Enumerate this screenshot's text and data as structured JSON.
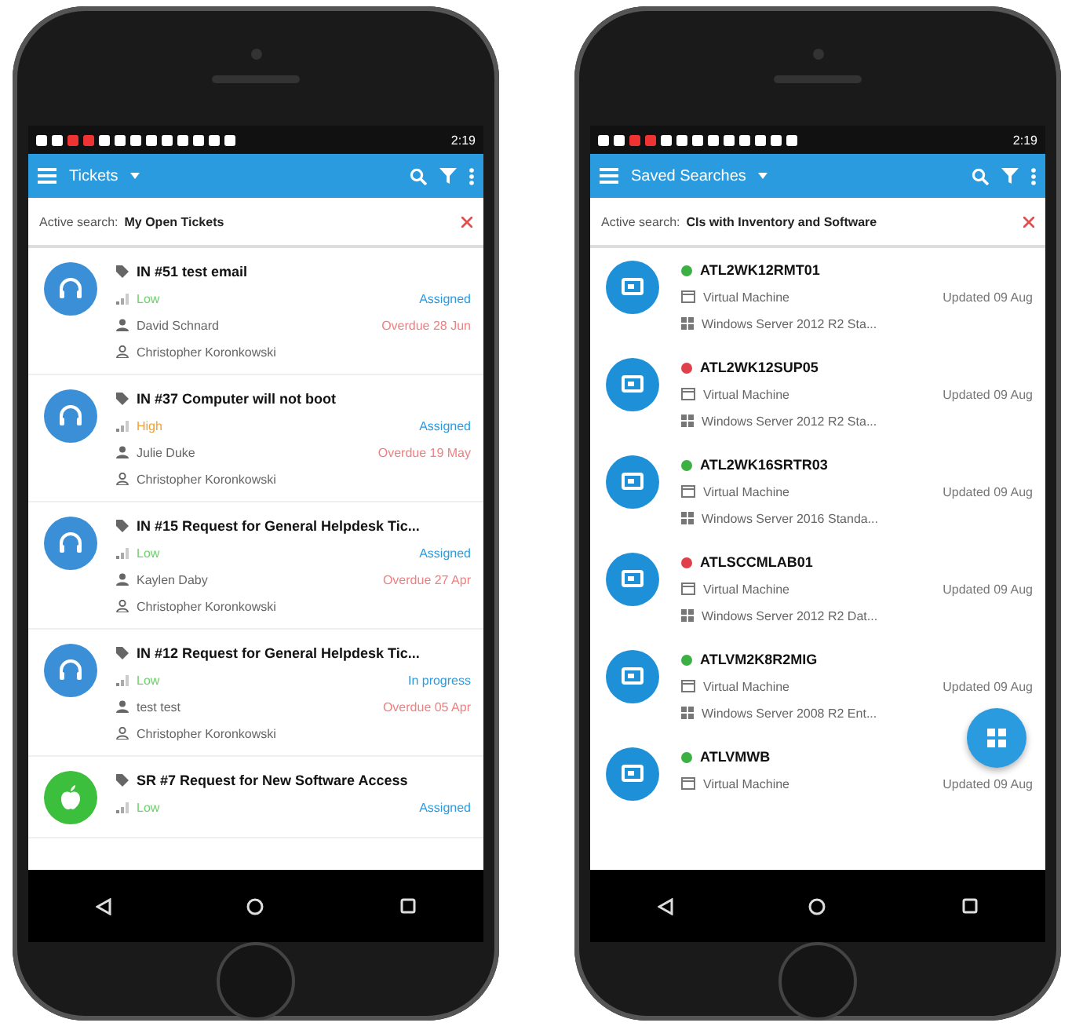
{
  "phones": [
    {
      "kind": "tickets",
      "status_time": "2:19",
      "title": "Tickets",
      "active_search_label": "Active search:",
      "active_search": "My Open Tickets",
      "items": [
        {
          "kind": "incident",
          "title": "IN #51 test email",
          "priority": "Low",
          "color": "#6fcf6f",
          "status": "Assigned",
          "requester": "David Schnard",
          "due": "Overdue 28 Jun",
          "assignee": "Christopher Koronkowski"
        },
        {
          "kind": "incident",
          "title": "IN #37 Computer will not boot",
          "priority": "High",
          "color": "#f0a030",
          "status": "Assigned",
          "requester": "Julie Duke",
          "due": "Overdue 19 May",
          "assignee": "Christopher Koronkowski"
        },
        {
          "kind": "incident",
          "title": "IN #15 Request for General Helpdesk Tic...",
          "priority": "Low",
          "color": "#6fcf6f",
          "status": "Assigned",
          "requester": "Kaylen Daby",
          "due": "Overdue 27 Apr",
          "assignee": "Christopher Koronkowski"
        },
        {
          "kind": "incident",
          "title": "IN #12 Request for General Helpdesk Tic...",
          "priority": "Low",
          "color": "#6fcf6f",
          "status": "In progress",
          "requester": "test test",
          "due": "Overdue 05 Apr",
          "assignee": "Christopher Koronkowski"
        },
        {
          "kind": "request",
          "title": "SR #7 Request for New Software Access",
          "priority": "Low",
          "color": "#6fcf6f",
          "status": "Assigned"
        }
      ]
    },
    {
      "kind": "assets",
      "status_time": "2:19",
      "title": "Saved Searches",
      "active_search_label": "Active search:",
      "active_search": "CIs with Inventory and Software",
      "items": [
        {
          "name": "ATL2WK12RMT01",
          "color": "#3cb043",
          "type": "Virtual Machine",
          "updated": "Updated 09 Aug",
          "os": "Windows Server 2012 R2 Sta..."
        },
        {
          "name": "ATL2WK12SUP05",
          "color": "#e0404a",
          "type": "Virtual Machine",
          "updated": "Updated 09 Aug",
          "os": "Windows Server 2012 R2 Sta..."
        },
        {
          "name": "ATL2WK16SRTR03",
          "color": "#3cb043",
          "type": "Virtual Machine",
          "updated": "Updated 09 Aug",
          "os": "Windows Server 2016 Standa..."
        },
        {
          "name": "ATLSCCMLAB01",
          "color": "#e0404a",
          "type": "Virtual Machine",
          "updated": "Updated 09 Aug",
          "os": "Windows Server 2012 R2 Dat..."
        },
        {
          "name": "ATLVM2K8R2MIG",
          "color": "#3cb043",
          "type": "Virtual Machine",
          "updated": "Updated 09 Aug",
          "os": "Windows Server 2008 R2 Ent..."
        },
        {
          "name": "ATLVMWB",
          "color": "#3cb043",
          "type": "Virtual Machine",
          "updated": "Updated 09 Aug"
        }
      ]
    }
  ]
}
